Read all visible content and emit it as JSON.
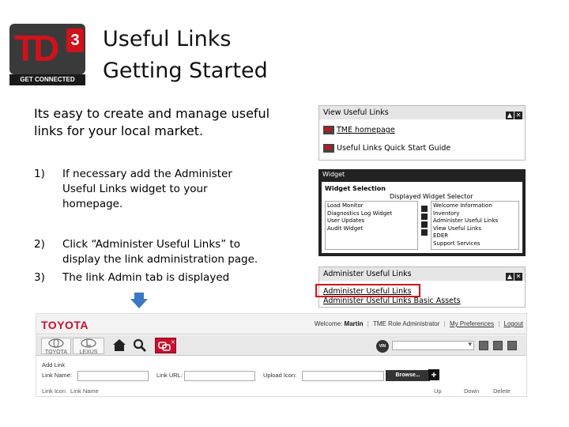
{
  "logo": {
    "mark": "TD",
    "superscript": "3",
    "tagline": "GET CONNECTED"
  },
  "title": {
    "line1": "Useful Links",
    "line2": "Getting Started"
  },
  "intro": "Its easy to create and manage useful links for your local market.",
  "steps": [
    {
      "num": "1)",
      "text": "If necessary add the Administer Useful Links widget to your homepage."
    },
    {
      "num": "2)",
      "text": "Click “Administer Useful Links” to display the link administration page."
    },
    {
      "num": "3)",
      "text": "The link Admin tab is displayed"
    }
  ],
  "view_panel": {
    "title": "View Useful Links",
    "items": [
      "TME homepage",
      "Useful Links Quick Start Guide"
    ]
  },
  "widget_panel": {
    "title": "Widget",
    "section": "Widget Selection",
    "displayed_label": "Displayed Widget Selector",
    "left_list": [
      "Load Monitor",
      "Diagnostics Log Widget",
      "User Updates",
      "Audit Widget"
    ],
    "right_list": [
      "Welcome Information",
      "Inventory",
      "Administer Useful Links",
      "View Useful Links",
      "EDER",
      "Support Services"
    ]
  },
  "admin_panel": {
    "title": "Administer Useful Links",
    "links": [
      "Administer Useful Links",
      "Administer Useful Links Basic Assets"
    ]
  },
  "app": {
    "brand": "TOYOTA",
    "welcome_prefix": "Welcome:",
    "user_name": "Martin",
    "role": "TME Role Administrator",
    "prefs": "My Preferences",
    "logout": "Logout",
    "tabs": [
      "TOYOTA",
      "LEXUS"
    ],
    "vin_badge": "VIN",
    "add_link_title": "Add Link",
    "link_name_label": "Link Name:",
    "link_url_label": "Link URL:",
    "upload_icon_label": "Upload Icon:",
    "browse": "Browse...",
    "plus": "+",
    "columns": {
      "icon": "Link Icon",
      "name": "Link Name",
      "up": "Up",
      "down": "Down",
      "delete": "Delete"
    }
  },
  "colors": {
    "brand_red": "#d0121b",
    "arrow_blue": "#3b78c4"
  }
}
